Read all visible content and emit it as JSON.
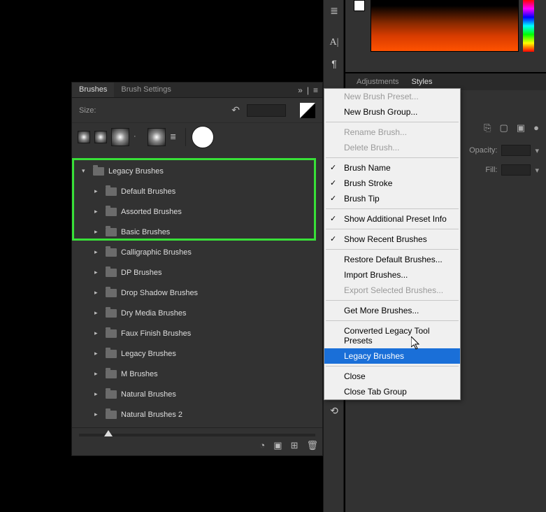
{
  "panel": {
    "tabs": {
      "brushes": "Brushes",
      "settings": "Brush Settings"
    },
    "size_label": "Size:"
  },
  "tree": {
    "root": "Legacy Brushes",
    "items": [
      "Default Brushes",
      "Assorted Brushes",
      "Basic Brushes",
      "Calligraphic Brushes",
      "DP Brushes",
      "Drop Shadow Brushes",
      "Dry Media Brushes",
      "Faux Finish Brushes",
      "Legacy Brushes",
      "M Brushes",
      "Natural Brushes",
      "Natural Brushes 2"
    ]
  },
  "right_tabs": {
    "adjustments": "Adjustments",
    "styles": "Styles"
  },
  "props": {
    "opacity": "Opacity:",
    "fill": "Fill:"
  },
  "menu": {
    "new_preset": "New Brush Preset...",
    "new_group": "New Brush Group...",
    "rename": "Rename Brush...",
    "delete": "Delete Brush...",
    "brush_name": "Brush Name",
    "brush_stroke": "Brush Stroke",
    "brush_tip": "Brush Tip",
    "show_additional": "Show Additional Preset Info",
    "show_recent": "Show Recent Brushes",
    "restore": "Restore Default Brushes...",
    "import": "Import Brushes...",
    "export": "Export Selected Brushes...",
    "get_more": "Get More Brushes...",
    "converted": "Converted Legacy Tool Presets",
    "legacy": "Legacy Brushes",
    "close": "Close",
    "close_tab": "Close Tab Group"
  }
}
